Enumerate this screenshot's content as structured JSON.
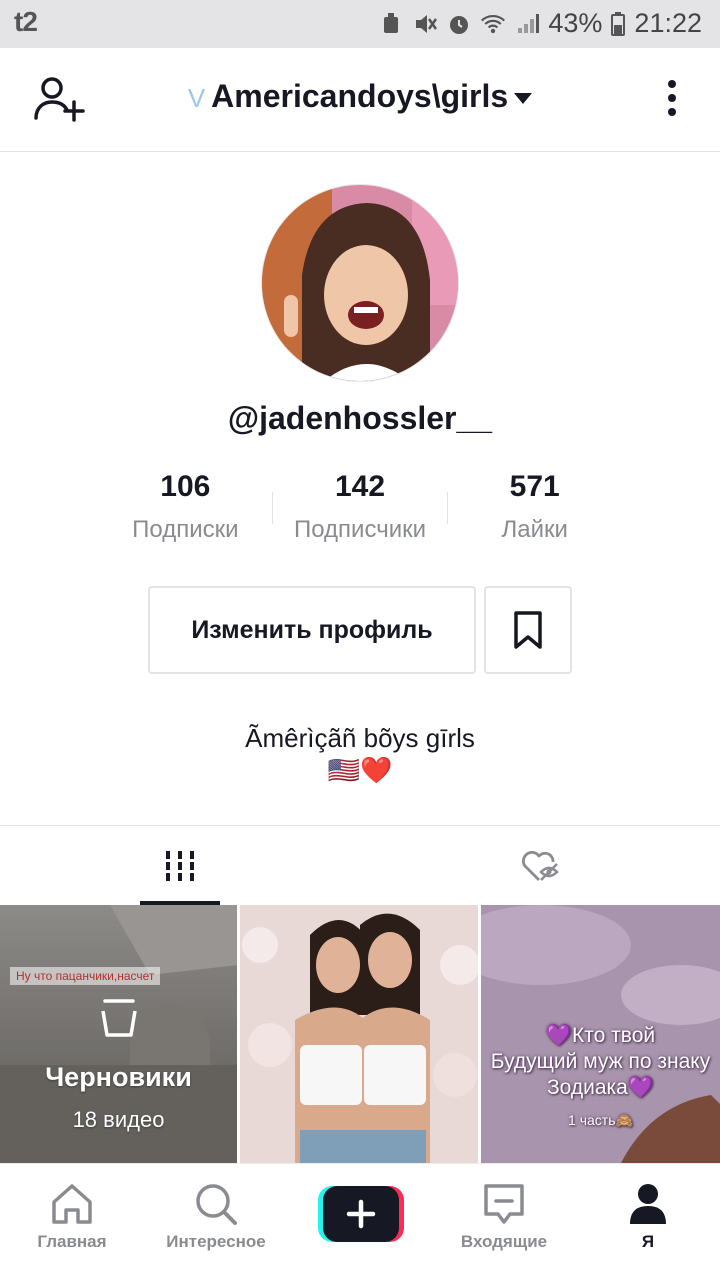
{
  "status_bar": {
    "carrier": "t2",
    "battery": "43%",
    "time": "21:22"
  },
  "header": {
    "title": "Americandoys\\girls",
    "title_prefix_icon": "chevron-down-icon"
  },
  "profile": {
    "username": "@jadenhossler__",
    "stats": [
      {
        "value": "106",
        "label": "Подписки"
      },
      {
        "value": "142",
        "label": "Подписчики"
      },
      {
        "value": "571",
        "label": "Лайки"
      }
    ],
    "edit_button_label": "Изменить профиль",
    "bio_line1": "Ãmêrìçãñ bõys gīrls",
    "bio_line2": "🇺🇸❤️"
  },
  "tabs": [
    "videos-grid-icon",
    "liked-hidden-icon"
  ],
  "grid": {
    "drafts_caption": "Ну что пацанчики,насчет",
    "drafts_label": "Черновики",
    "drafts_count": "18 видео",
    "cell3_line1": "💜Кто твой",
    "cell3_line2": "Будущий муж по знаку",
    "cell3_line3": "Зодиака💜",
    "cell3_line4": "1 часть🙈"
  },
  "bottom_nav": [
    {
      "label": "Главная"
    },
    {
      "label": "Интересное"
    },
    {
      "label": "Входящие"
    },
    {
      "label": "Я"
    }
  ],
  "colors": {
    "text": "#161823",
    "secondary": "#8a8b91",
    "border": "#e3e3e4",
    "create_cyan": "#25f4ee",
    "create_pink": "#fe2c55"
  }
}
